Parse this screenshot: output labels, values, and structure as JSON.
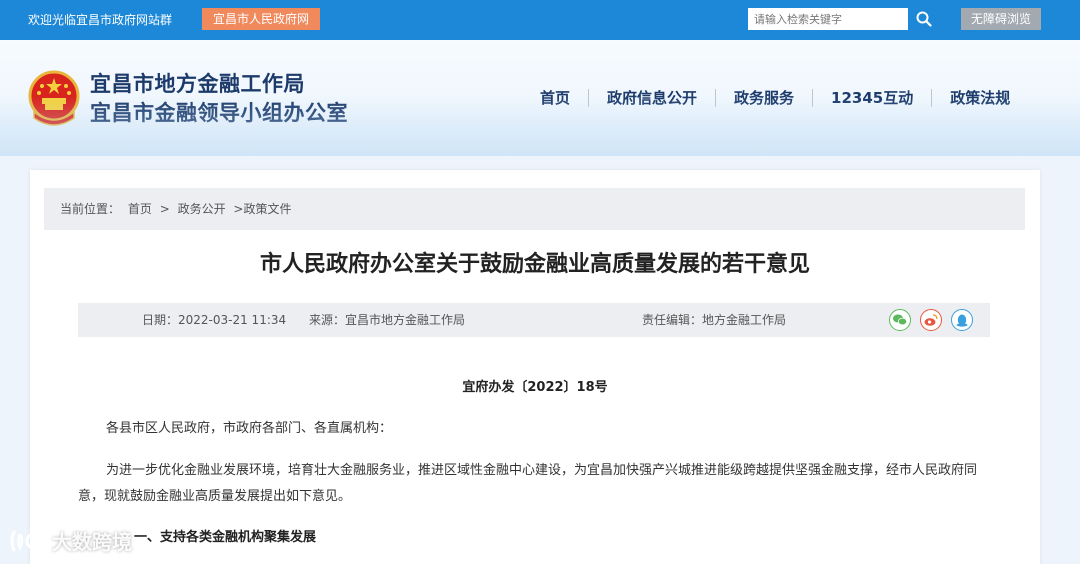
{
  "topbar": {
    "welcome": "欢迎光临宜昌市政府网站群",
    "portal_link": "宜昌市人民政府网",
    "search_placeholder": "请输入检索关键字",
    "accessibility": "无障碍浏览"
  },
  "header": {
    "title_line1": "宜昌市地方金融工作局",
    "title_line2": "宜昌市金融领导小组办公室",
    "nav": [
      "首页",
      "政府信息公开",
      "政务服务",
      "12345互动",
      "政策法规"
    ]
  },
  "breadcrumb": {
    "label": "当前位置：",
    "items": [
      "首页",
      ">",
      "政务公开",
      ">政策文件"
    ]
  },
  "article": {
    "title": "市人民政府办公室关于鼓励金融业高质量发展的若干意见",
    "date": "日期：2022-03-21 11:34",
    "source": "来源：宜昌市地方金融工作局",
    "editor": "责任编辑：地方金融工作局",
    "share_icons": [
      "wechat-icon",
      "weibo-icon",
      "qq-icon"
    ],
    "doc_number": "宜府办发〔2022〕18号",
    "salutation": "各县市区人民政府，市政府各部门、各直属机构：",
    "intro": "为进一步优化金融业发展环境，培育壮大金融服务业，推进区域性金融中心建设，为宜昌加快强产兴城推进能级跨越提供坚强金融支撑，经市人民政府同意，现就鼓励金融业高质量发展提出如下意见。",
    "section1": "一、支持各类金融机构聚集发展"
  },
  "watermark": "大数跨境",
  "colors": {
    "topbar": "#1e88d8",
    "portal_link": "#f08a5d",
    "title": "#1c3b6b",
    "accessibility_btn": "#a3a9b0"
  }
}
